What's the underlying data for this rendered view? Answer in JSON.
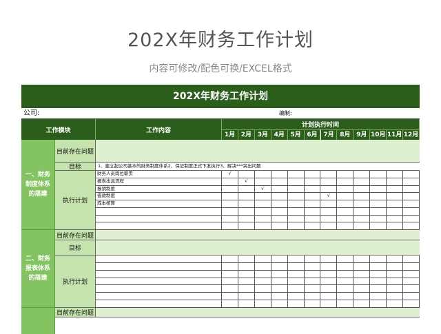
{
  "header": {
    "title": "202X年财务工作计划",
    "subtitle": "内容可修改/配色可换/EXCEL格式"
  },
  "sheet": {
    "title": "202X年财务工作计划",
    "company_label": "公司:",
    "editor_label": "编制:",
    "columns": {
      "module": "工作模块",
      "content": "工作内容",
      "schedule": "计划执行时间"
    },
    "months": [
      "1月",
      "2月",
      "3月",
      "4月",
      "5月",
      "6月",
      "7月",
      "8月",
      "9月",
      "10月",
      "11月",
      "12月"
    ],
    "check_mark": "√",
    "sections": [
      {
        "name": "一、财务制度体系的搭建",
        "problem_label": "目前存在问题",
        "goal_label": "目标",
        "goal_text": "1、建立起公司基本的财务制度体系2、保证制度正式下发执行3、解决***突出问题",
        "plan_label": "执行计划",
        "tasks": [
          {
            "label": "财务人员岗位职责",
            "check_month": 1
          },
          {
            "label": "报表出具流程",
            "check_month": 2
          },
          {
            "label": "报销制度",
            "check_month": 3
          },
          {
            "label": "借款制度",
            "check_month": 7
          },
          {
            "label": "成本核算",
            "check_month": 0
          },
          {
            "label": "",
            "check_month": 0
          },
          {
            "label": "",
            "check_month": 0
          },
          {
            "label": "",
            "check_month": 0
          }
        ]
      },
      {
        "name": "二、财务报表体系的搭建",
        "problem_label": "目前存在问题",
        "goal_label": "目标",
        "plan_label": "执行计划",
        "tasks": [
          {
            "label": "",
            "check_month": 0
          },
          {
            "label": "",
            "check_month": 0
          },
          {
            "label": "",
            "check_month": 0
          },
          {
            "label": "",
            "check_month": 0
          },
          {
            "label": "",
            "check_month": 0
          },
          {
            "label": "",
            "check_month": 0
          },
          {
            "label": "",
            "check_month": 0
          }
        ]
      },
      {
        "problem_label": "目前存在问题"
      }
    ]
  }
}
